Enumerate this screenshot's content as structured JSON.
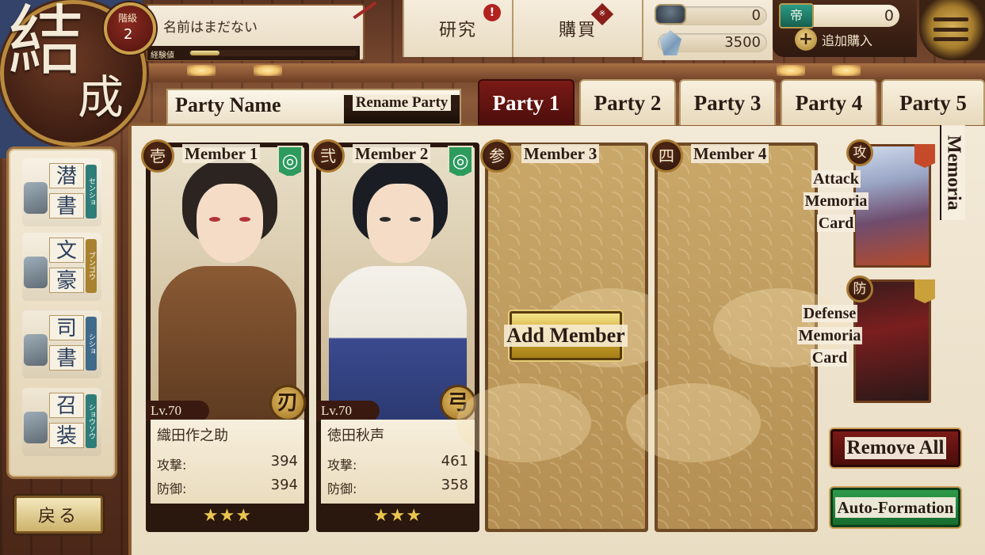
{
  "screen_title": [
    "結",
    "成"
  ],
  "player": {
    "rank_label": "階級",
    "rank_value": "2",
    "name": "名前はまだない",
    "exp_label": "経験値",
    "exp_fraction": 0.18
  },
  "top_nav": {
    "research": "研究",
    "research_alert": "!",
    "purchase": "購買",
    "purchase_badge": "※"
  },
  "currencies": {
    "ink": "0",
    "gems": "3500",
    "tickets": "0",
    "ticket_icon_text": "帝",
    "buy_more": "追加購入",
    "plus_glyph": "+"
  },
  "sidebar": {
    "items": [
      {
        "kanji": [
          "潜",
          "書"
        ],
        "kana": "センショ",
        "color": "teal"
      },
      {
        "kanji": [
          "文",
          "豪"
        ],
        "kana": "ブンゴウ",
        "color": "gold"
      },
      {
        "kanji": [
          "司",
          "書"
        ],
        "kana": "シショ",
        "color": "blue"
      },
      {
        "kanji": [
          "召",
          "装"
        ],
        "kana": "ショウソウ",
        "color": "teal"
      }
    ],
    "back": "戻る"
  },
  "party": {
    "name_label": "Party Name",
    "rename": "Rename Party",
    "tabs": [
      "Party 1",
      "Party 2",
      "Party 3",
      "Party 4",
      "Party 5"
    ],
    "active_tab": 0
  },
  "members": [
    {
      "slot_mark": "壱",
      "slot_label": "Member 1",
      "element_glyph": "◎",
      "level": "Lv.70",
      "weapon": "刃",
      "name": "織田作之助",
      "attack_label": "攻撃:",
      "attack": "394",
      "defense_label": "防御:",
      "defense": "394",
      "stars": "★★★"
    },
    {
      "slot_mark": "弐",
      "slot_label": "Member 2",
      "element_glyph": "◎",
      "level": "Lv.70",
      "weapon": "弓",
      "name": "徳田秋声",
      "attack_label": "攻撃:",
      "attack": "461",
      "defense_label": "防御:",
      "defense": "358",
      "stars": "★★★"
    },
    {
      "slot_mark": "参",
      "slot_label": "Member 3"
    },
    {
      "slot_mark": "四",
      "slot_label": "Member 4"
    }
  ],
  "add_member": "Add Member",
  "memoria": {
    "tab_label": "Memoria",
    "attack_badge": "攻",
    "attack_caption": [
      "Attack",
      "Memoria",
      "Card"
    ],
    "defense_badge": "防",
    "defense_caption": [
      "Defense",
      "Memoria",
      "Card"
    ]
  },
  "actions": {
    "remove_all": "Remove All",
    "auto_formation": "Auto-Formation"
  },
  "colors": {
    "active_tab": "#7a1a16",
    "element_green": "#2d9a5e",
    "auto_formation_green": "#2e9a4a",
    "remove_all_red": "#7a1a16"
  }
}
